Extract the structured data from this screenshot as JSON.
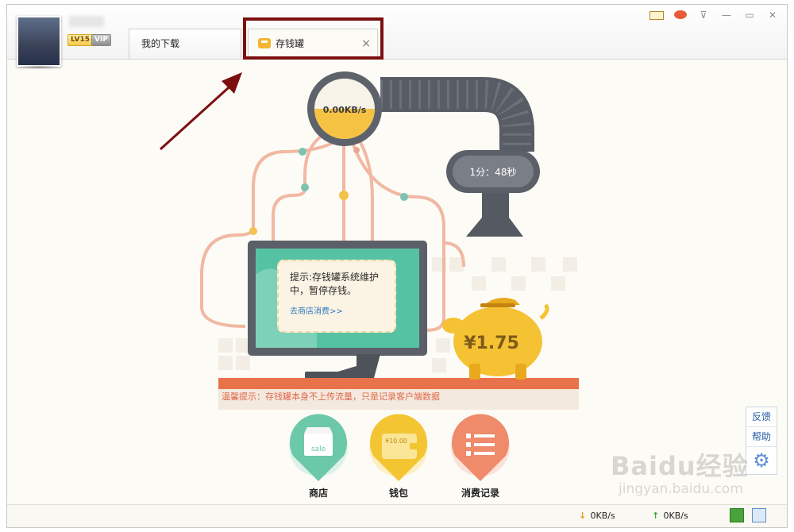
{
  "user": {
    "level": "LV15",
    "vip": "VIP"
  },
  "tabs": [
    {
      "label": "我的下载",
      "active": false
    },
    {
      "label": "存钱罐",
      "active": true,
      "close": "×"
    }
  ],
  "window_controls": [
    "mail-icon",
    "skin-icon",
    "menu-icon",
    "minimize-icon",
    "maximize-icon",
    "close-icon"
  ],
  "piggy_bank": {
    "speed": "0.00KB/s",
    "timer": "1分：48秒",
    "notice_text": "提示:存钱罐系统维护中，暂停存钱。",
    "store_link": "去商店消费>>",
    "balance": "¥1.75",
    "warm_tip": "温馨提示：存钱罐本身不上传流量，只是记录客户端数据"
  },
  "actions": [
    {
      "id": "store",
      "label": "商店",
      "badge": "sale",
      "color": "#6bc8a9"
    },
    {
      "id": "wallet",
      "label": "钱包",
      "badge": "¥10.00",
      "color": "#f4c533"
    },
    {
      "id": "history",
      "label": "消费记录",
      "color": "#ef8a6a"
    }
  ],
  "side_panel": {
    "feedback": "反馈",
    "help": "帮助"
  },
  "status": {
    "download": "0KB/s",
    "upload": "0KB/s"
  },
  "watermark": {
    "brand": "Baidu经验",
    "url": "jingyan.baidu.com"
  }
}
